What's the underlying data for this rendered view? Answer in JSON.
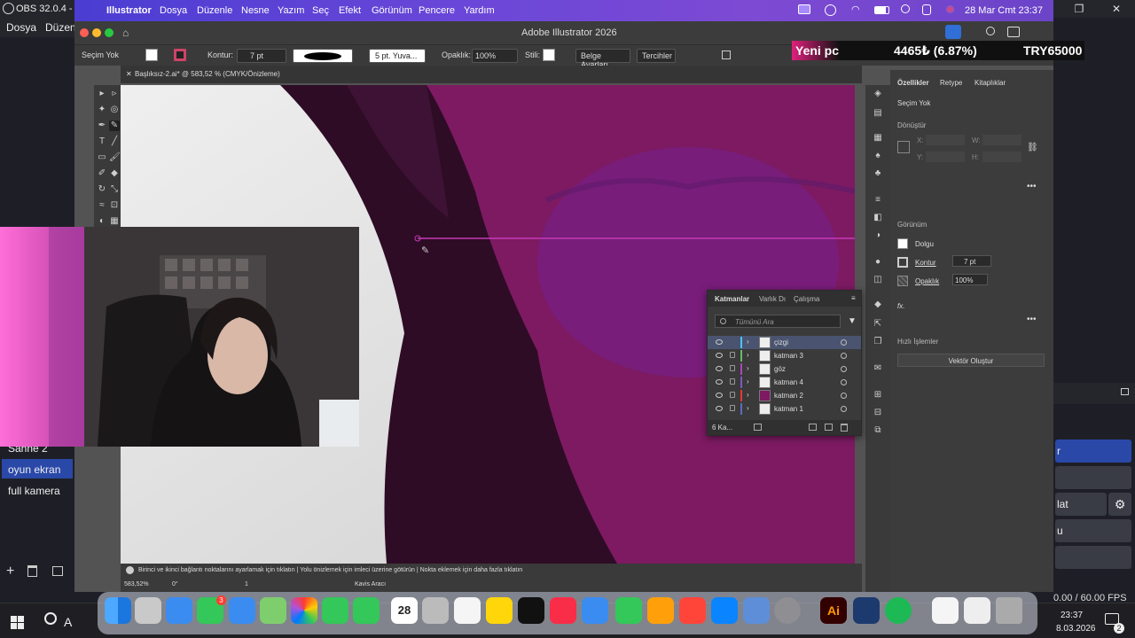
{
  "obs": {
    "title": "OBS 32.0.4 - Pr",
    "menu": [
      "Dosya",
      "Düzen"
    ],
    "scenes": [
      {
        "label": "Sahne 2",
        "selected": false
      },
      {
        "label": "oyun ekran",
        "selected": true
      },
      {
        "label": "full kamera",
        "selected": false
      }
    ],
    "right_buttons": [
      "r",
      "",
      "lat",
      "u",
      ""
    ],
    "fps": "0.00 / 60.00 FPS",
    "window_controls": [
      "—",
      "❐",
      "✕"
    ]
  },
  "taskbar": {
    "time": "23:37",
    "date": "8.03.2026",
    "search_stub": "A",
    "notification_count": "2"
  },
  "mac_menubar": {
    "app": "Illustrator",
    "items": [
      "Dosya",
      "Düzenle",
      "Nesne",
      "Yazım",
      "Seç",
      "Efekt",
      "Görünüm",
      "Pencere",
      "Yardım"
    ],
    "clock": "28 Mar Cmt  23:37"
  },
  "illustrator": {
    "window_title": "Adobe Illustrator 2026",
    "control_bar": {
      "selection": "Seçim Yok",
      "stroke_label": "Kontur:",
      "stroke_value": "7 pt",
      "brush_label": "5 pt. Yuva...",
      "opacity_label": "Opaklık:",
      "opacity_value": "100%",
      "style_label": "Stili:",
      "doc_setup": "Belge Ayarları",
      "prefs": "Tercihler"
    },
    "doc_tab": "Başlıksız-2.ai* @ 583,52 % (CMYK/Önizleme)",
    "status_hint": "Birinci ve ikinci bağlantı noktalarını ayarlamak için tıklatın  |  Yolu önizlemek için imleci üzerine götürün  |  Nokta eklemek için daha fazla tıklatın",
    "zoom": "583,52%",
    "angle": "0°",
    "artboard": "1",
    "tool_name": "Kavis Aracı",
    "props": {
      "tabs": [
        "Özellikler",
        "Retype",
        "Kitaplıklar"
      ],
      "selection": "Seçim Yok",
      "transform": "Dönüştür",
      "x": "X:",
      "y": "Y:",
      "w": "W:",
      "h": "H:",
      "appearance": "Görünüm",
      "fill": "Dolgu",
      "stroke": "Kontur",
      "stroke_value": "7 pt",
      "opacity": "Opaklık",
      "opacity_value": "100%",
      "fx": "fx.",
      "quick_actions": "Hızlı İşlemler",
      "vectorize": "Vektör Oluştur"
    },
    "layers_panel": {
      "tabs": [
        "Katmanlar",
        "Varlık Dı",
        "Çalışma"
      ],
      "search_placeholder": "Tümünü Ara",
      "count": "6 Ka...",
      "layers": [
        {
          "name": "çizgi",
          "color": "#4fc3f7",
          "selected": true
        },
        {
          "name": "katman 3",
          "color": "#66bb6a",
          "selected": false
        },
        {
          "name": "göz",
          "color": "#ab47bc",
          "selected": false
        },
        {
          "name": "katman 4",
          "color": "#7e57c2",
          "selected": false
        },
        {
          "name": "katman 2",
          "color": "#e53935",
          "selected": false
        },
        {
          "name": "katman 1",
          "color": "#5c6bc0",
          "selected": false
        }
      ]
    }
  },
  "ticker": {
    "label": "Yeni pc",
    "value": "4465₺ (6.87%)",
    "goal": "TRY65000"
  },
  "dock": {
    "apps": [
      "finder",
      "launchpad",
      "safari",
      "messages",
      "mail",
      "maps",
      "photos",
      "facetime",
      "phone",
      "calendar",
      "contacts",
      "reminders",
      "notes",
      "tv",
      "music",
      "keynote",
      "numbers",
      "pages",
      "rocket",
      "appstore",
      "preview",
      "settings",
      "illustrator",
      "vpn",
      "spotify",
      "doc",
      "screen",
      "trash"
    ],
    "calendar_day": "28",
    "messages_badge": "3",
    "illustrator_label": "Ai"
  },
  "colors": {
    "magenta": "#7d1a62",
    "dark_purple": "#2e0c25",
    "accent_blue": "#2a48a8",
    "ticker_pink": "#e0207d"
  }
}
